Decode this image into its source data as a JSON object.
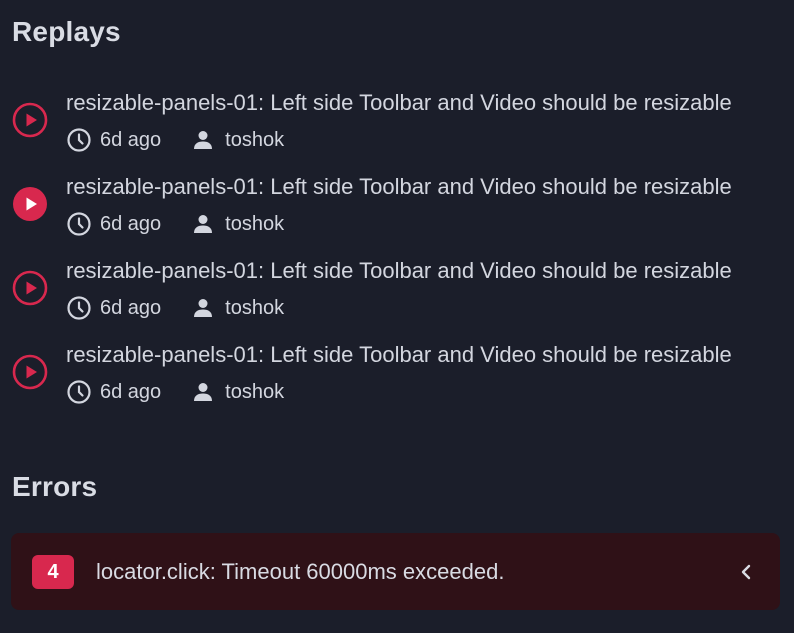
{
  "replays": {
    "title": "Replays",
    "items": [
      {
        "title": "resizable-panels-01: Left side Toolbar and Video should be resizable",
        "time": "6d ago",
        "user": "toshok",
        "active": false
      },
      {
        "title": "resizable-panels-01: Left side Toolbar and Video should be resizable",
        "time": "6d ago",
        "user": "toshok",
        "active": true
      },
      {
        "title": "resizable-panels-01: Left side Toolbar and Video should be resizable",
        "time": "6d ago",
        "user": "toshok",
        "active": false
      },
      {
        "title": "resizable-panels-01: Left side Toolbar and Video should be resizable",
        "time": "6d ago",
        "user": "toshok",
        "active": false
      }
    ]
  },
  "errors": {
    "title": "Errors",
    "items": [
      {
        "count": "4",
        "message": "locator.click: Timeout 60000ms exceeded."
      }
    ]
  },
  "icons": {
    "play": "play-circle-icon",
    "clock": "clock-icon",
    "user": "user-icon",
    "chevron": "chevron-left-icon"
  },
  "colors": {
    "background": "#1b1e2a",
    "accent": "#d8284e",
    "error_card": "#2f1117",
    "text": "#d3d6df"
  }
}
